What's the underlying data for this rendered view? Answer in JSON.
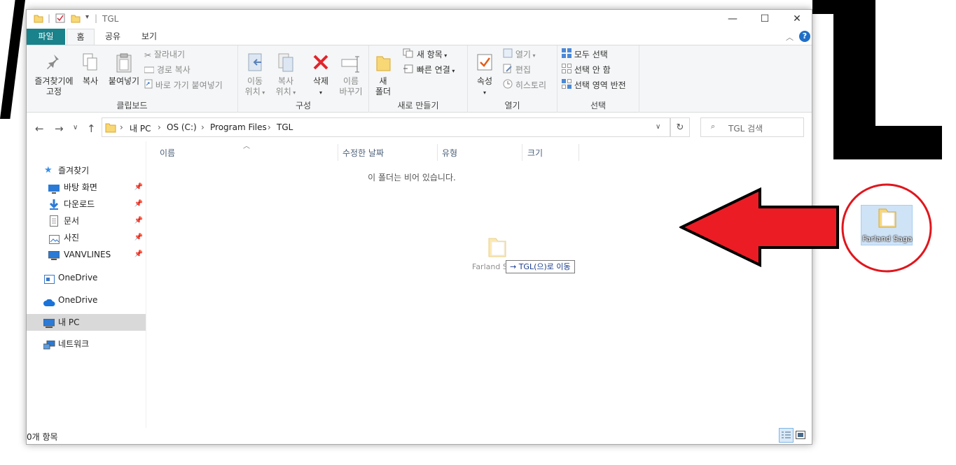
{
  "window": {
    "title": "TGL",
    "controls": {
      "minimize": "—",
      "maximize": "☐",
      "close": "✕"
    }
  },
  "tabs": [
    "파일",
    "홈",
    "공유",
    "보기"
  ],
  "ribbon": {
    "clipboard": {
      "label": "클립보드",
      "pin_line1": "즐겨찾기에",
      "pin_line2": "고정",
      "copy": "복사",
      "paste": "붙여넣기",
      "cut": "잘라내기",
      "copy_path": "경로 복사",
      "paste_shortcut": "바로 가기 붙여넣기"
    },
    "organize": {
      "label": "구성",
      "move_line1": "이동",
      "move_line2": "위치",
      "copy_line1": "복사",
      "copy_line2": "위치",
      "delete": "삭제",
      "rename_line1": "이름",
      "rename_line2": "바꾸기"
    },
    "new": {
      "label": "새로 만들기",
      "folder_line1": "새",
      "folder_line2": "폴더",
      "new_item": "새 항목",
      "easy_access": "빠른 연결"
    },
    "open": {
      "label": "열기",
      "properties": "속성",
      "open": "열기",
      "edit": "편집",
      "history": "히스토리"
    },
    "select": {
      "label": "선택",
      "select_all": "모두 선택",
      "select_none": "선택 안 함",
      "invert": "선택 영역 반전"
    }
  },
  "address": {
    "crumbs": [
      "내 PC",
      "OS (C:)",
      "Program Files",
      "TGL"
    ],
    "search_placeholder": "TGL 검색"
  },
  "nav": {
    "quick_access": "즐겨찾기",
    "items": [
      "바탕 화면",
      "다운로드",
      "문서",
      "사진",
      "VANVLINES"
    ],
    "onedrive1": "OneDrive",
    "onedrive2": "OneDrive",
    "this_pc": "내 PC",
    "network": "네트워크"
  },
  "columns": [
    "이름",
    "수정한 날짜",
    "유형",
    "크기"
  ],
  "empty_message": "이 폴더는 비어 있습니다.",
  "status": "0개 항목",
  "drag": {
    "ghost_label": "Farland S",
    "tooltip": "→ TGL(으)로 이동"
  },
  "desktop_icon": {
    "label": "Farland Saga"
  },
  "colors": {
    "file_tab": "#19828a",
    "arrow": "#ec1c24",
    "circle": "#e0161d",
    "selection": "#d9d9d9"
  }
}
